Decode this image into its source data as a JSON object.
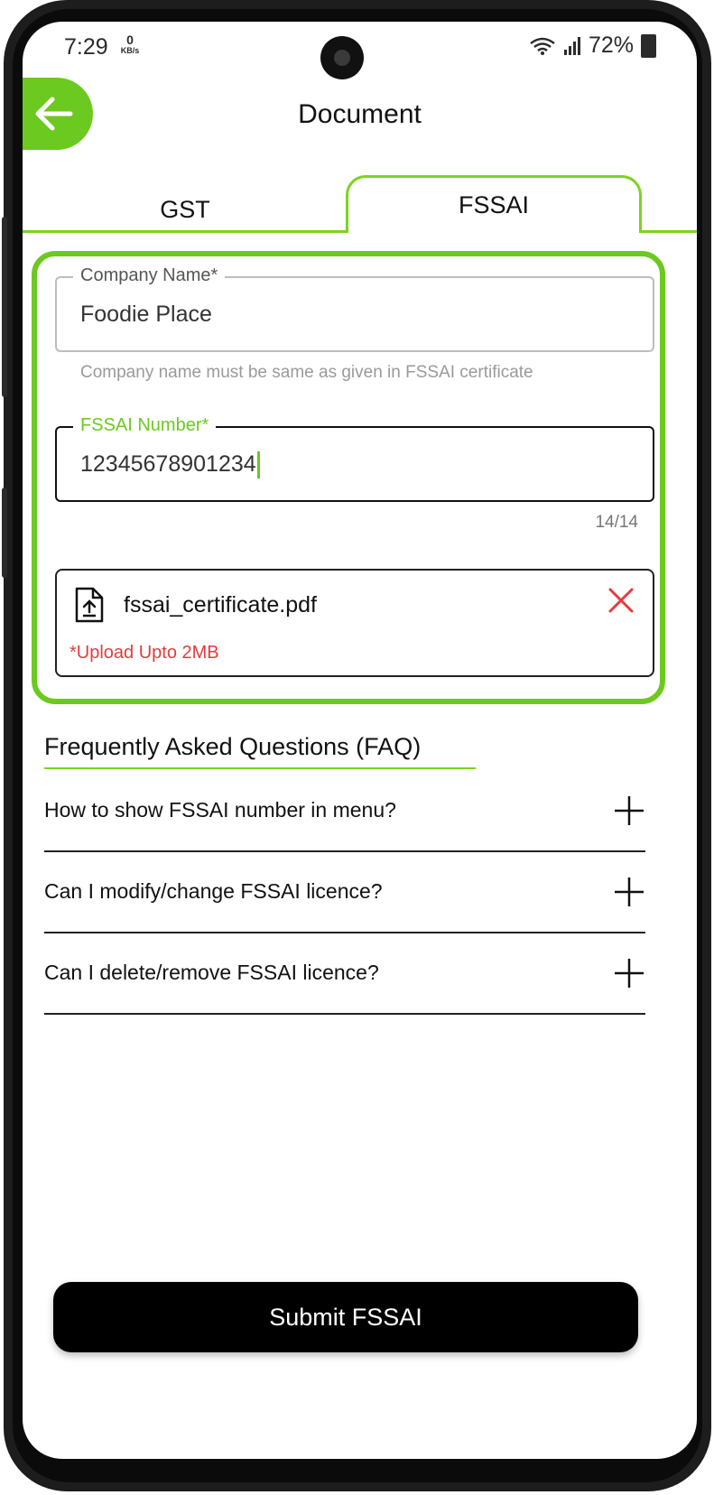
{
  "status_bar": {
    "time": "7:29",
    "speed_value": "0",
    "speed_unit": "KB/s",
    "battery": "72%"
  },
  "header": {
    "title": "Document",
    "back_icon": "arrow-left-icon"
  },
  "tabs": [
    {
      "label": "GST",
      "active": false
    },
    {
      "label": "FSSAI",
      "active": true
    }
  ],
  "form": {
    "company_name": {
      "label": "Company Name*",
      "value": "Foodie Place",
      "helper": "Company name must be same as given in FSSAI certificate"
    },
    "fssai_number": {
      "label": "FSSAI Number*",
      "value": "12345678901234",
      "counter": "14/14"
    },
    "upload": {
      "file_name": "fssai_certificate.pdf",
      "note": "*Upload Upto 2MB",
      "file_icon": "file-upload-icon",
      "remove_icon": "close-icon"
    }
  },
  "faq": {
    "title": "Frequently Asked Questions (FAQ)",
    "items": [
      {
        "question": "How to show FSSAI number in menu?"
      },
      {
        "question": "Can I modify/change FSSAI licence?"
      },
      {
        "question": "Can I delete/remove FSSAI licence?"
      }
    ]
  },
  "submit": {
    "label": "Submit FSSAI"
  },
  "colors": {
    "accent": "#7ed321",
    "error": "#e23c3c",
    "primary_button": "#000000"
  }
}
